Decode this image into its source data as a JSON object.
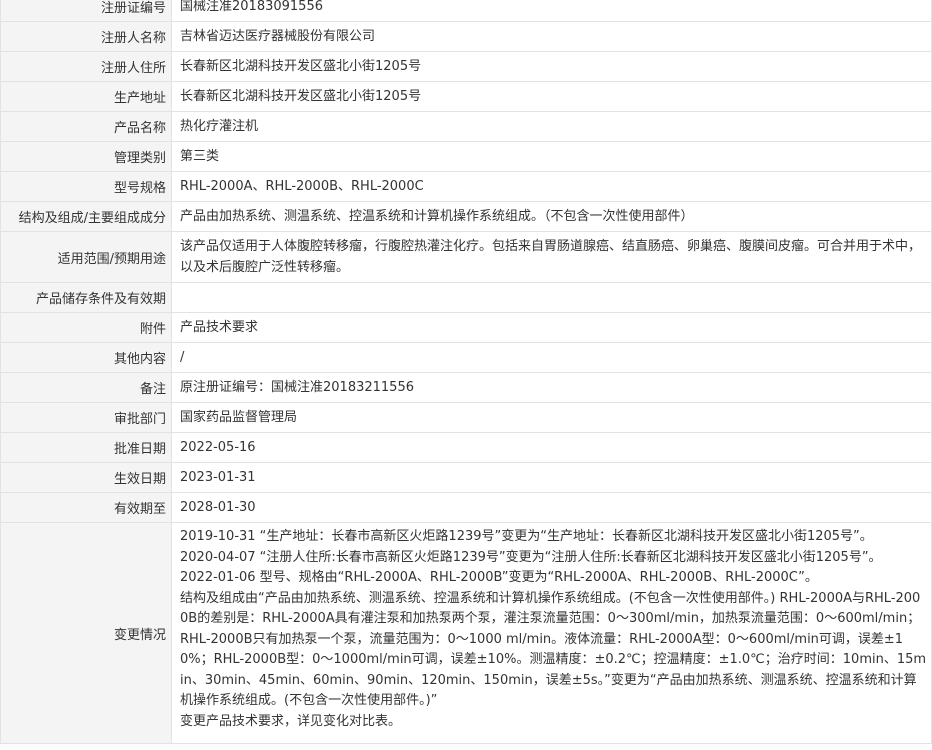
{
  "rows": [
    {
      "label": "注册证编号",
      "value": "国械注准20183091556"
    },
    {
      "label": "注册人名称",
      "value": "吉林省迈达医疗器械股份有限公司"
    },
    {
      "label": "注册人住所",
      "value": "长春新区北湖科技开发区盛北小街1205号"
    },
    {
      "label": "生产地址",
      "value": "长春新区北湖科技开发区盛北小街1205号"
    },
    {
      "label": "产品名称",
      "value": "热化疗灌注机"
    },
    {
      "label": "管理类别",
      "value": "第三类"
    },
    {
      "label": "型号规格",
      "value": "RHL-2000A、RHL-2000B、RHL-2000C"
    },
    {
      "label": "结构及组成/主要组成成分",
      "value": "产品由加热系统、测温系统、控温系统和计算机操作系统组成。（不包含一次性使用部件）"
    },
    {
      "label": "适用范围/预期用途",
      "value": "该产品仅适用于人体腹腔转移瘤，行腹腔热灌注化疗。包括来自胃肠道腺癌、结直肠癌、卵巢癌、腹膜间皮瘤。可合并用于术中，以及术后腹腔广泛性转移瘤。"
    },
    {
      "label": "产品储存条件及有效期",
      "value": ""
    },
    {
      "label": "附件",
      "value": "产品技术要求"
    },
    {
      "label": "其他内容",
      "value": "/"
    },
    {
      "label": "备注",
      "value": "原注册证编号：国械注准20183211556"
    },
    {
      "label": "审批部门",
      "value": "国家药品监督管理局"
    },
    {
      "label": "批准日期",
      "value": "2022-05-16"
    },
    {
      "label": "生效日期",
      "value": "2023-01-31"
    },
    {
      "label": "有效期至",
      "value": "2028-01-30"
    }
  ],
  "changes": {
    "label": "变更情况",
    "lines": [
      "2019-10-31 “生产地址：长春市高新区火炬路1239号”变更为“生产地址：长春新区北湖科技开发区盛北小街1205号”。",
      "2020-04-07 “注册人住所:长春市高新区火炬路1239号”变更为“注册人住所:长春新区北湖科技开发区盛北小街1205号”。",
      "2022-01-06 型号、规格由“RHL-2000A、RHL-2000B”变更为“RHL-2000A、RHL-2000B、RHL-2000C”。",
      "结构及组成由“产品由加热系统、测温系统、控温系统和计算机操作系统组成。(不包含一次性使用部件。) RHL-2000A与RHL-2000B的差别是：RHL-2000A具有灌注泵和加热泵两个泵，灌注泵流量范围：0～300ml/min，加热泵流量范围：0～600ml/min；RHL-2000B只有加热泵一个泵，流量范围为：0～1000 ml/min。液体流量：RHL-2000A型：0～600ml/min可调，误差±10%；RHL-2000B型：0～1000ml/min可调，误差±10%。测温精度：±0.2℃；控温精度：±1.0℃；治疗时间：10min、15min、30min、45min、60min、90min、120min、150min，误差±5s。”变更为“产品由加热系统、测温系统、控温系统和计算机操作系统组成。(不包含一次性使用部件。)”",
      "变更产品技术要求，详见变化对比表。"
    ]
  }
}
